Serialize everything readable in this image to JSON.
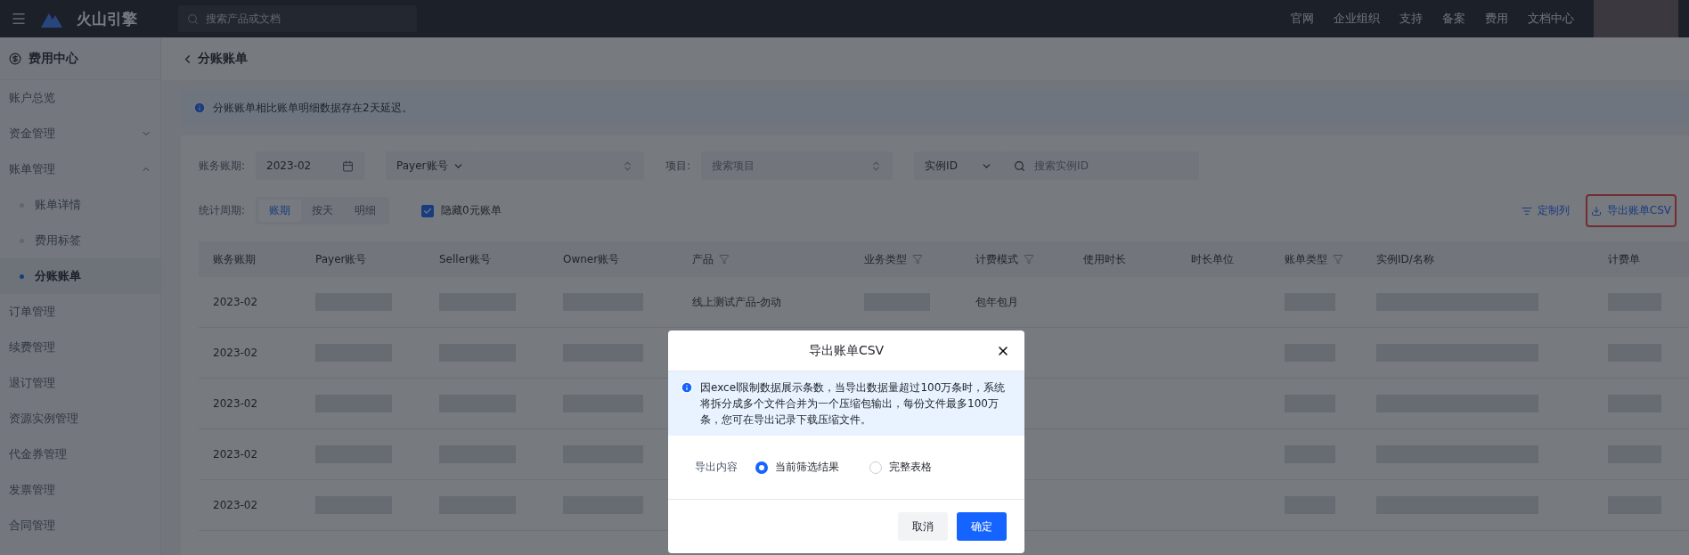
{
  "topbar": {
    "brand": "火山引擎",
    "search": {
      "placeholder": "搜索产品或文档"
    },
    "links": [
      "官网",
      "企业组织",
      "支持",
      "备案",
      "费用",
      "文档中心"
    ]
  },
  "sidebar": {
    "title": "费用中心",
    "items": [
      {
        "label": "账户总览",
        "selected": false
      },
      {
        "label": "资金管理",
        "expanded": false,
        "selected": false
      },
      {
        "label": "账单管理",
        "expanded": true,
        "selected": false,
        "children": [
          {
            "label": "账单详情",
            "selected": false
          },
          {
            "label": "费用标签",
            "selected": false
          },
          {
            "label": "分账账单",
            "selected": true
          }
        ]
      },
      {
        "label": "订单管理",
        "selected": false
      },
      {
        "label": "续费管理",
        "selected": false
      },
      {
        "label": "退订管理",
        "selected": false
      },
      {
        "label": "资源实例管理",
        "selected": false
      },
      {
        "label": "代金券管理",
        "selected": false
      },
      {
        "label": "发票管理",
        "selected": false
      },
      {
        "label": "合同管理",
        "selected": false
      }
    ]
  },
  "breadcrumb": "分账账单",
  "notice": "分账账单相比账单明细数据存在2天延迟。",
  "filters": {
    "period_label": "账务账期:",
    "period_value": "2023-02",
    "account_select": "Payer账号",
    "project_label": "项目:",
    "project_placeholder": "搜索项目",
    "instance_select": "实例ID",
    "instance_placeholder": "搜索实例ID"
  },
  "cycle": {
    "label": "统计周期:",
    "options": [
      {
        "label": "账期",
        "selected": true
      },
      {
        "label": "按天",
        "selected": false
      },
      {
        "label": "明细",
        "selected": false
      }
    ]
  },
  "hide_zero": {
    "label": "隐藏0元账单",
    "checked": true
  },
  "actions": [
    {
      "kind": "columns",
      "label": "定制列",
      "highlighted": false
    },
    {
      "kind": "export",
      "label": "导出账单CSV",
      "highlighted": true
    }
  ],
  "table": {
    "columns": [
      {
        "label": "账务账期",
        "filter": false
      },
      {
        "label": "Payer账号",
        "filter": false
      },
      {
        "label": "Seller账号",
        "filter": false
      },
      {
        "label": "Owner账号",
        "filter": false
      },
      {
        "label": "产品",
        "filter": true
      },
      {
        "label": "业务类型",
        "filter": true
      },
      {
        "label": "计费模式",
        "filter": true
      },
      {
        "label": "使用时长",
        "filter": false
      },
      {
        "label": "时长单位",
        "filter": false
      },
      {
        "label": "账单类型",
        "filter": true
      },
      {
        "label": "实例ID/名称",
        "filter": false
      },
      {
        "label": "计费单",
        "filter": false
      }
    ],
    "rows": [
      {
        "cells": [
          {
            "kind": "text",
            "text": "2023-02"
          },
          {
            "kind": "redacted"
          },
          {
            "kind": "redacted"
          },
          {
            "kind": "redacted"
          },
          {
            "kind": "text",
            "text": "线上测试产品-勿动"
          },
          {
            "kind": "redacted"
          },
          {
            "kind": "text",
            "text": "包年包月"
          },
          {
            "kind": "empty"
          },
          {
            "kind": "empty"
          },
          {
            "kind": "redacted"
          },
          {
            "kind": "redacted"
          },
          {
            "kind": "redacted"
          }
        ]
      },
      {
        "cells": [
          {
            "kind": "text",
            "text": "2023-02"
          },
          {
            "kind": "redacted"
          },
          {
            "kind": "redacted"
          },
          {
            "kind": "redacted"
          },
          {
            "kind": "empty"
          },
          {
            "kind": "empty"
          },
          {
            "kind": "empty"
          },
          {
            "kind": "empty"
          },
          {
            "kind": "empty"
          },
          {
            "kind": "redacted"
          },
          {
            "kind": "redacted"
          },
          {
            "kind": "redacted"
          }
        ]
      },
      {
        "cells": [
          {
            "kind": "text",
            "text": "2023-02"
          },
          {
            "kind": "redacted"
          },
          {
            "kind": "redacted"
          },
          {
            "kind": "redacted"
          },
          {
            "kind": "empty"
          },
          {
            "kind": "empty"
          },
          {
            "kind": "empty"
          },
          {
            "kind": "empty"
          },
          {
            "kind": "empty"
          },
          {
            "kind": "redacted"
          },
          {
            "kind": "redacted"
          },
          {
            "kind": "redacted"
          }
        ]
      },
      {
        "cells": [
          {
            "kind": "text",
            "text": "2023-02"
          },
          {
            "kind": "redacted"
          },
          {
            "kind": "redacted"
          },
          {
            "kind": "redacted"
          },
          {
            "kind": "empty"
          },
          {
            "kind": "empty"
          },
          {
            "kind": "empty"
          },
          {
            "kind": "empty"
          },
          {
            "kind": "empty"
          },
          {
            "kind": "redacted"
          },
          {
            "kind": "redacted"
          },
          {
            "kind": "redacted"
          }
        ]
      },
      {
        "cells": [
          {
            "kind": "text",
            "text": "2023-02"
          },
          {
            "kind": "redacted"
          },
          {
            "kind": "redacted"
          },
          {
            "kind": "redacted"
          },
          {
            "kind": "empty"
          },
          {
            "kind": "empty"
          },
          {
            "kind": "empty"
          },
          {
            "kind": "empty"
          },
          {
            "kind": "empty"
          },
          {
            "kind": "redacted"
          },
          {
            "kind": "redacted"
          },
          {
            "kind": "redacted"
          }
        ]
      }
    ]
  },
  "dialog": {
    "title": "导出账单CSV",
    "notice": "因excel限制数据展示条数，当导出数据量超过100万条时，系统将拆分成多个文件合并为一个压缩包输出，每份文件最多100万条，您可在导出记录下载压缩文件。",
    "field_label": "导出内容",
    "options": [
      {
        "label": "当前筛选结果",
        "selected": true
      },
      {
        "label": "完整表格",
        "selected": false
      }
    ],
    "buttons": [
      {
        "kind": "secondary",
        "label": "取消"
      },
      {
        "kind": "primary",
        "label": "确定"
      }
    ]
  }
}
